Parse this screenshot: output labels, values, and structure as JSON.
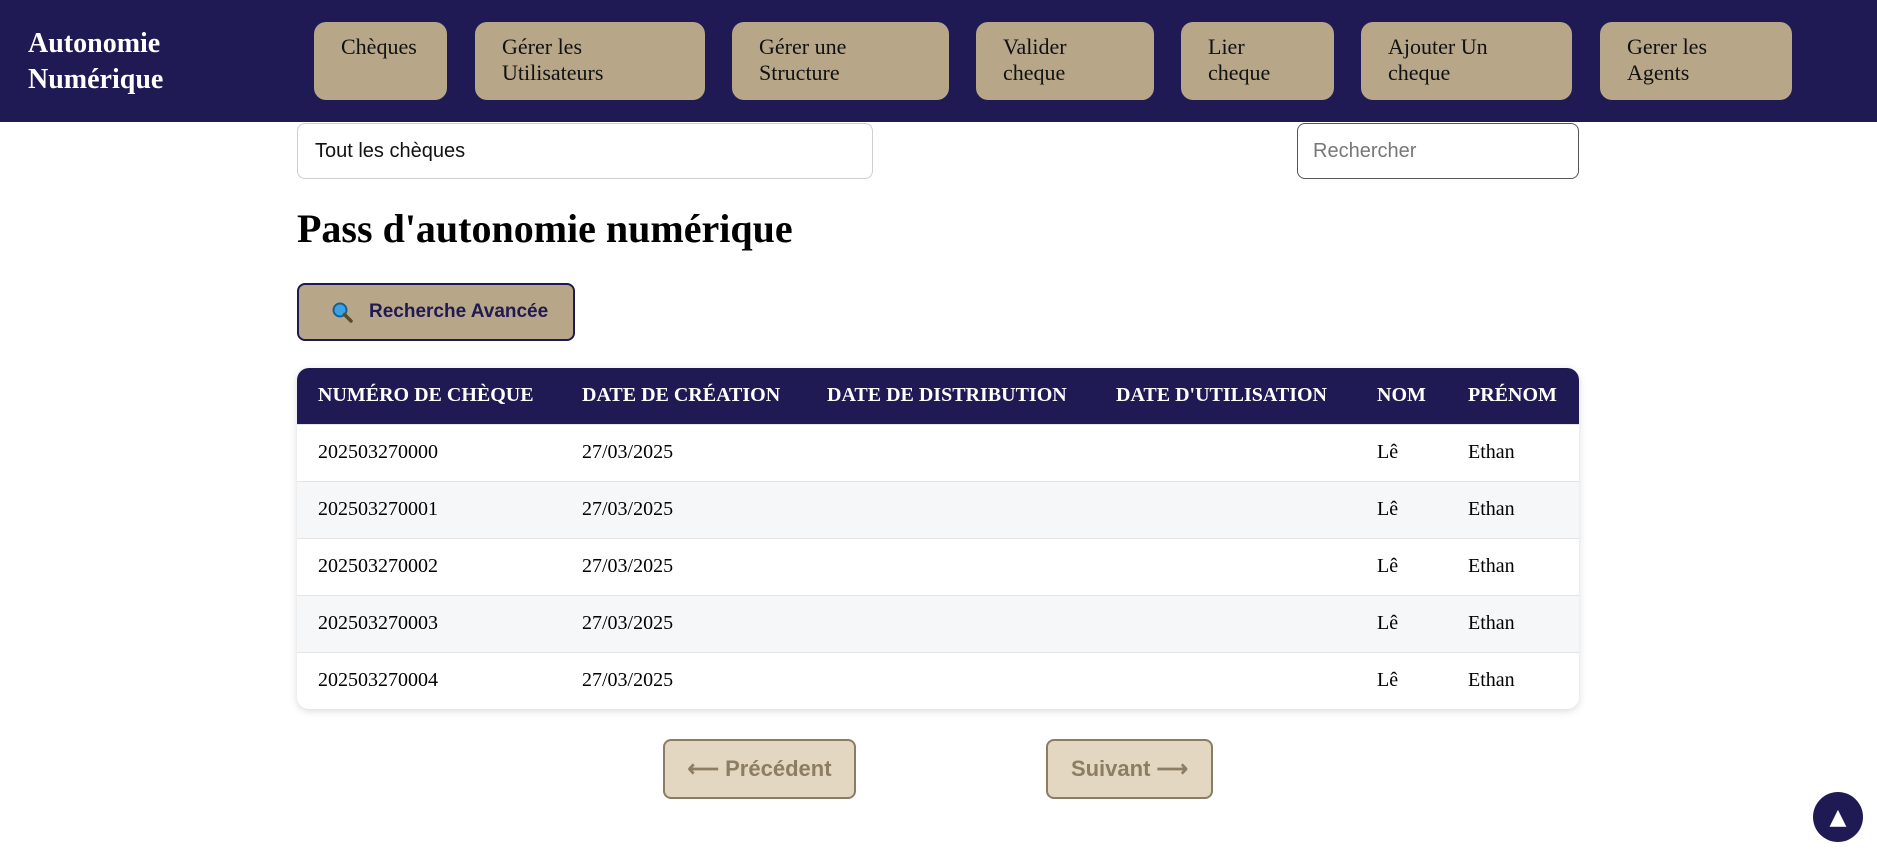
{
  "brand": {
    "line1": "Autonomie",
    "line2": "Numérique"
  },
  "nav": [
    {
      "label": "Chèques"
    },
    {
      "label": "Gérer les Utilisateurs"
    },
    {
      "label": "Gérer une Structure"
    },
    {
      "label": "Valider cheque"
    },
    {
      "label": "Lier cheque"
    },
    {
      "label": "Ajouter Un cheque"
    },
    {
      "label": "Gerer les Agents"
    }
  ],
  "filter": {
    "selected": "Tout les chèques"
  },
  "search": {
    "placeholder": "Rechercher"
  },
  "page_title": "Pass d'autonomie numérique",
  "advanced_search": {
    "icon": "magnifier-icon",
    "label": "Recherche Avancée"
  },
  "table": {
    "headers": [
      "NUMÉRO DE CHÈQUE",
      "DATE DE CRÉATION",
      "DATE DE DISTRIBUTION",
      "DATE D'UTILISATION",
      "NOM",
      "PRÉNOM"
    ],
    "rows": [
      [
        "202503270000",
        "27/03/2025",
        "",
        "",
        "Lê",
        "Ethan"
      ],
      [
        "202503270001",
        "27/03/2025",
        "",
        "",
        "Lê",
        "Ethan"
      ],
      [
        "202503270002",
        "27/03/2025",
        "",
        "",
        "Lê",
        "Ethan"
      ],
      [
        "202503270003",
        "27/03/2025",
        "",
        "",
        "Lê",
        "Ethan"
      ],
      [
        "202503270004",
        "27/03/2025",
        "",
        "",
        "Lê",
        "Ethan"
      ]
    ]
  },
  "pagination": {
    "prev": "⟵ Précédent",
    "next": "Suivant ⟶"
  },
  "scroll_top": {
    "icon": "arrow-up-icon",
    "glyph": "▲"
  },
  "colors": {
    "navy": "#1f1a54",
    "tan": "#b7a688",
    "light_tan": "#e3d7c2"
  }
}
